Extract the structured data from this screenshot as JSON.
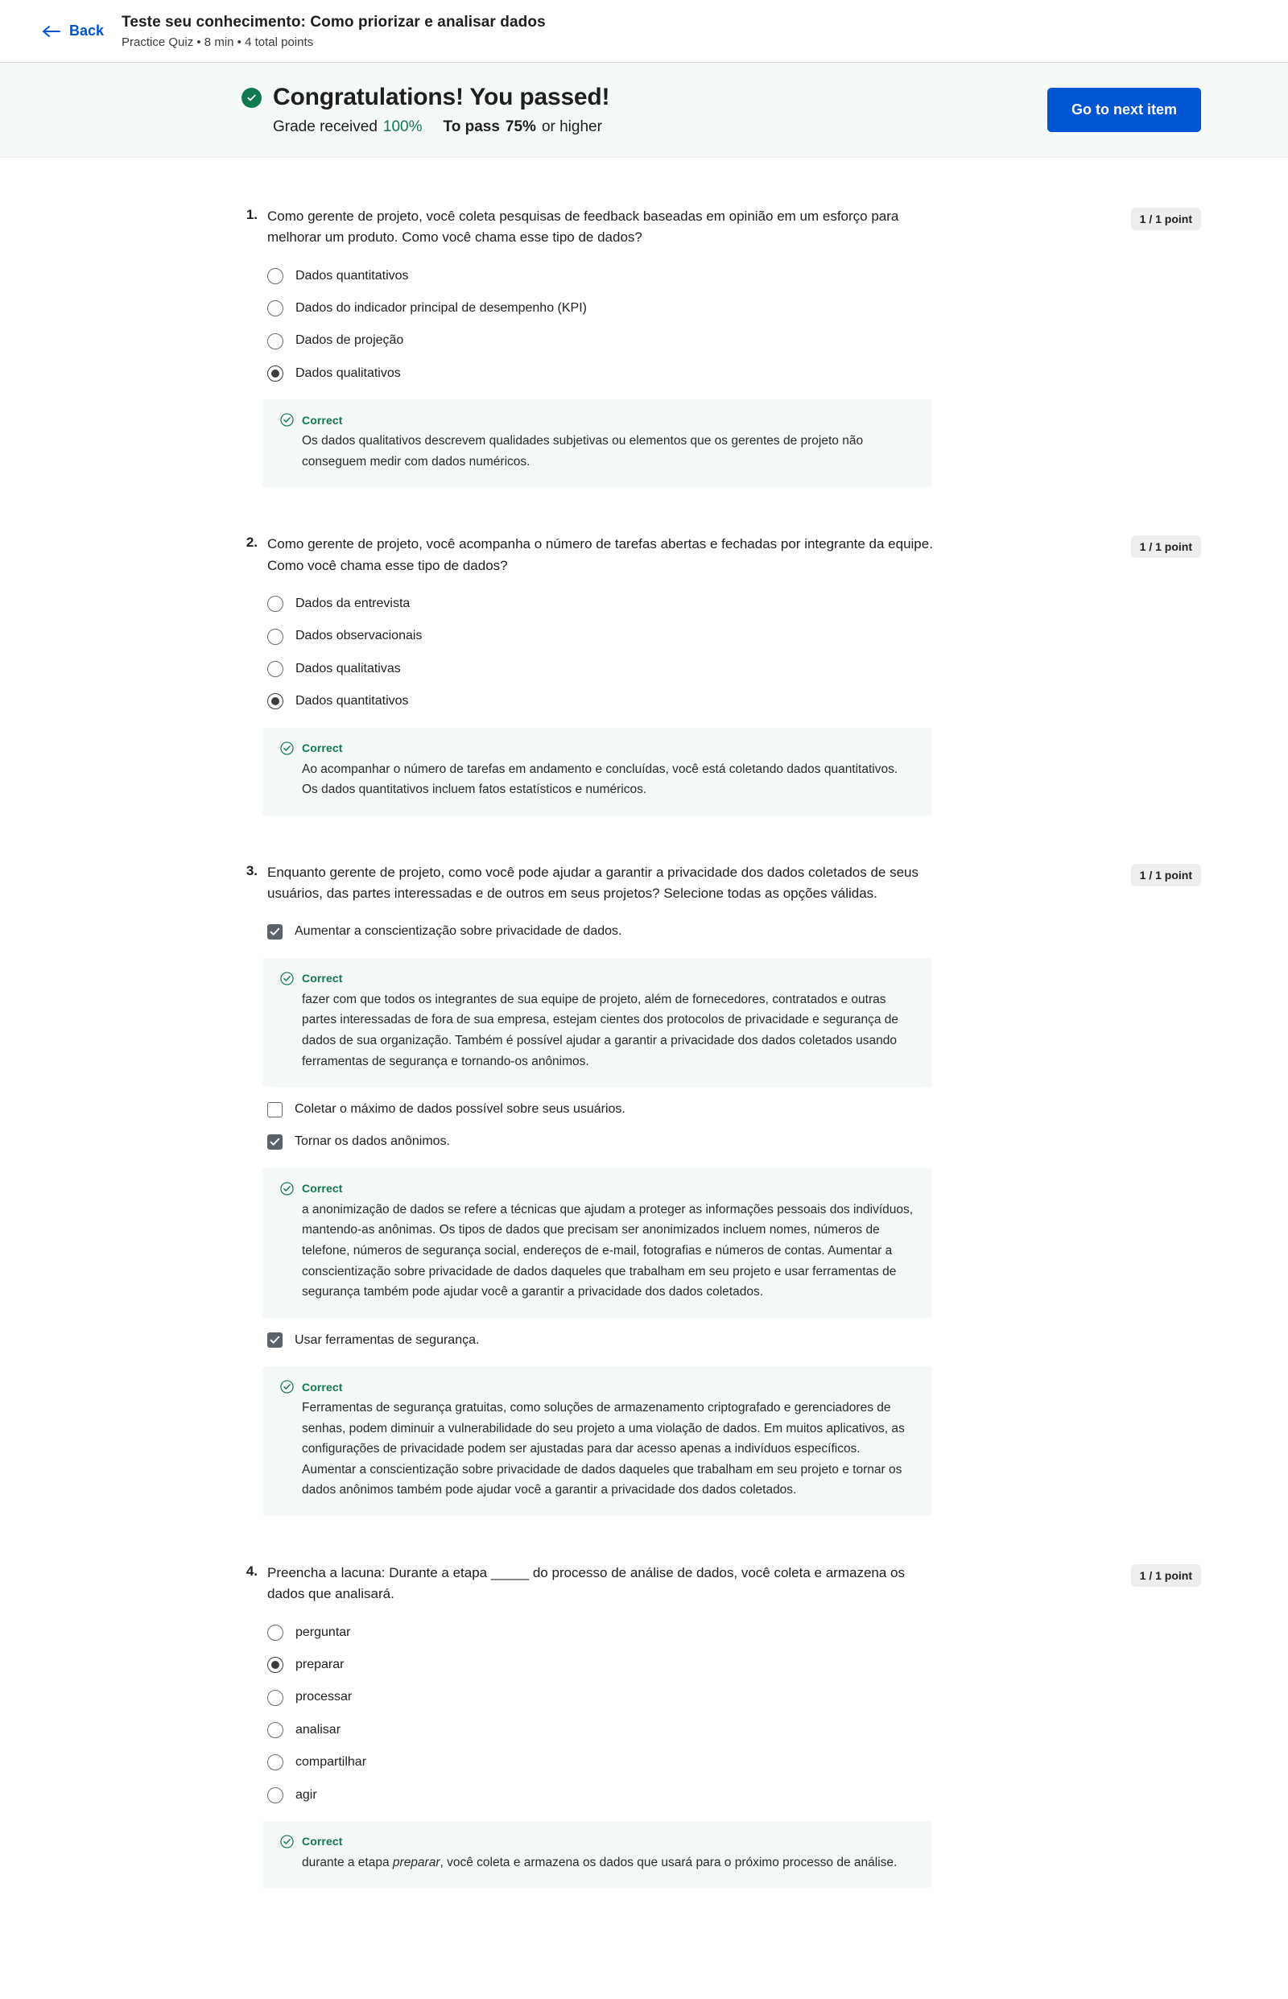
{
  "header": {
    "back_label": "Back",
    "back_icon": "arrow-left-icon",
    "title": "Teste seu conhecimento: Como priorizar e analisar dados",
    "subtitle": "Practice Quiz • 8 min • 4 total points"
  },
  "banner": {
    "status_icon": "check-circle-icon",
    "headline": "Congratulations! You passed!",
    "grade_label": "Grade received",
    "grade_value": "100%",
    "pass_label": "To pass",
    "pass_value": "75%",
    "pass_suffix": "or higher",
    "next_button": "Go to next item",
    "accent_color": "#0056D2",
    "success_color": "#0f7a50",
    "banner_bg": "#f5f9f7"
  },
  "questions": [
    {
      "number": "1.",
      "points": "1 / 1 point",
      "text": "Como gerente de projeto, você coleta pesquisas de feedback baseadas em opinião em um esforço para melhorar um produto. Como você chama esse tipo de dados?",
      "type": "radio",
      "options": [
        {
          "label": "Dados quantitativos",
          "selected": false
        },
        {
          "label": "Dados do indicador principal de desempenho (KPI)",
          "selected": false
        },
        {
          "label": "Dados de projeção",
          "selected": false
        },
        {
          "label": "Dados qualitativos",
          "selected": true
        }
      ],
      "feedback": [
        {
          "title": "Correct",
          "body": "Os dados qualitativos descrevem qualidades subjetivas ou elementos que os gerentes de projeto não conseguem medir com dados numéricos.",
          "after_option_index": 3
        }
      ]
    },
    {
      "number": "2.",
      "points": "1 / 1 point",
      "text": "Como gerente de projeto, você acompanha o número de tarefas abertas e fechadas por integrante da equipe. Como você chama esse tipo de dados?",
      "type": "radio",
      "options": [
        {
          "label": "Dados da entrevista",
          "selected": false
        },
        {
          "label": "Dados observacionais",
          "selected": false
        },
        {
          "label": "Dados qualitativas",
          "selected": false
        },
        {
          "label": "Dados quantitativos",
          "selected": true
        }
      ],
      "feedback": [
        {
          "title": "Correct",
          "body": "Ao acompanhar o número de tarefas em andamento e concluídas, você está coletando dados quantitativos. Os dados quantitativos incluem fatos estatísticos e numéricos.",
          "after_option_index": 3
        }
      ]
    },
    {
      "number": "3.",
      "points": "1 / 1 point",
      "text": "Enquanto gerente de projeto, como você pode ajudar a garantir a privacidade dos dados coletados de seus usuários, das partes interessadas e de outros em seus projetos? Selecione todas as opções válidas.",
      "type": "checkbox",
      "options": [
        {
          "label": "Aumentar a conscientização sobre privacidade de dados.",
          "selected": true
        },
        {
          "label": "Coletar o máximo de dados possível sobre seus usuários.",
          "selected": false
        },
        {
          "label": "Tornar os dados anônimos.",
          "selected": true
        },
        {
          "label": "Usar ferramentas de segurança.",
          "selected": true
        }
      ],
      "feedback": [
        {
          "title": "Correct",
          "body": "fazer com que todos os integrantes de sua equipe de projeto, além de fornecedores, contratados e outras partes interessadas de fora de sua empresa, estejam cientes dos protocolos de privacidade e segurança de dados de sua organização. Também é possível ajudar a garantir a privacidade dos dados coletados usando ferramentas de segurança e tornando-os anônimos.",
          "after_option_index": 0
        },
        {
          "title": "Correct",
          "body": "a anonimização de dados se refere a técnicas que ajudam a proteger as informações pessoais dos indivíduos, mantendo-as anônimas. Os tipos de dados que precisam ser anonimizados incluem nomes, números de telefone, números de segurança social, endereços de e-mail, fotografias e números de contas. Aumentar a conscientização sobre privacidade de dados daqueles que trabalham em seu projeto e usar ferramentas de segurança também pode ajudar você a garantir a privacidade dos dados coletados.",
          "after_option_index": 2
        },
        {
          "title": "Correct",
          "body": "Ferramentas de segurança gratuitas, como soluções de armazenamento criptografado e gerenciadores de senhas, podem diminuir a vulnerabilidade do seu projeto a uma violação de dados. Em muitos aplicativos, as configurações de privacidade podem ser ajustadas para dar acesso apenas a indivíduos específicos. Aumentar a conscientização sobre privacidade de dados daqueles que trabalham em seu projeto e tornar os dados anônimos também pode ajudar você a garantir a privacidade dos dados coletados.",
          "after_option_index": 3
        }
      ]
    },
    {
      "number": "4.",
      "points": "1 / 1 point",
      "text": "Preencha a lacuna: Durante a etapa _____ do processo de análise de dados, você coleta e armazena os dados que analisará.",
      "type": "radio",
      "options": [
        {
          "label": "perguntar",
          "selected": false
        },
        {
          "label": "preparar",
          "selected": true
        },
        {
          "label": "processar",
          "selected": false
        },
        {
          "label": "analisar",
          "selected": false
        },
        {
          "label": "compartilhar",
          "selected": false
        },
        {
          "label": "agir",
          "selected": false
        }
      ],
      "feedback": [
        {
          "title": "Correct",
          "body_html": "durante a etapa <em>preparar</em>, você coleta e armazena os dados que usará para o próximo processo de análise.",
          "after_option_index": 5
        }
      ]
    }
  ]
}
